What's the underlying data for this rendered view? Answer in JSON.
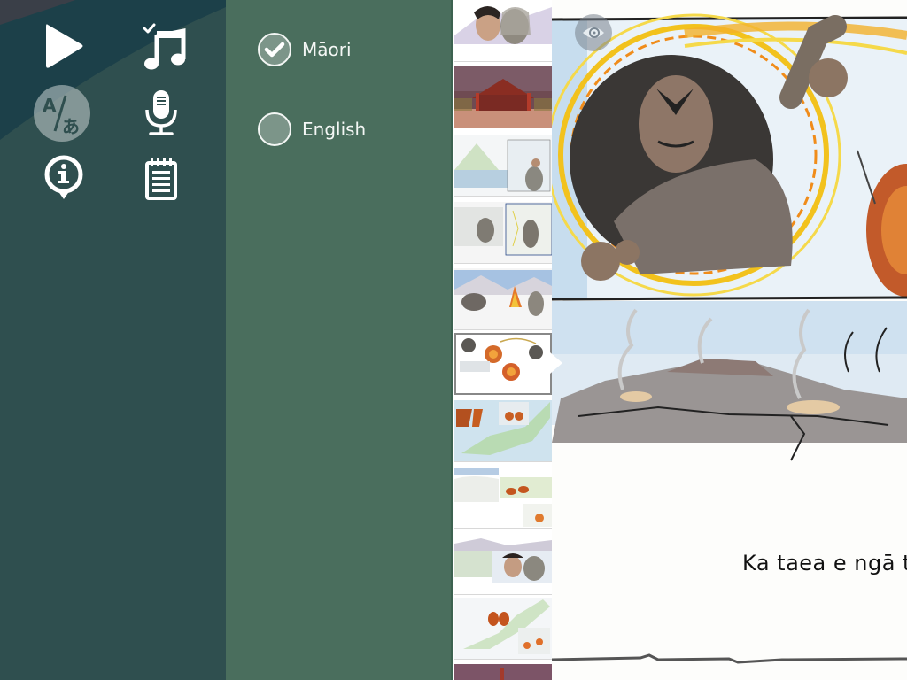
{
  "sidebar": {
    "buttons": [
      {
        "id": "play",
        "icon": "play-icon",
        "label": "Play"
      },
      {
        "id": "music",
        "icon": "music-note-icon",
        "label": "Music",
        "checked": true
      },
      {
        "id": "language",
        "icon": "translate-icon",
        "label": "Language",
        "active": true
      },
      {
        "id": "record",
        "icon": "microphone-icon",
        "label": "Record"
      },
      {
        "id": "info",
        "icon": "info-icon",
        "label": "Info"
      },
      {
        "id": "notes",
        "icon": "notepad-icon",
        "label": "Notes"
      }
    ],
    "translate_glyph_a": "A",
    "translate_glyph_b": "あ"
  },
  "language_panel": {
    "options": [
      {
        "label": "Māori",
        "selected": true
      },
      {
        "label": "English",
        "selected": false
      }
    ]
  },
  "thumbnails": {
    "count_visible": 10,
    "selected_index": 5,
    "items": [
      {
        "name": "two-figures-mountain"
      },
      {
        "name": "marae-meeting-house"
      },
      {
        "name": "mountain-lake-warrior"
      },
      {
        "name": "warriors-in-snow"
      },
      {
        "name": "fire-in-snow"
      },
      {
        "name": "fireballs-flying"
      },
      {
        "name": "map-with-fireballs"
      },
      {
        "name": "fireballs-landing"
      },
      {
        "name": "two-figures-landscape"
      },
      {
        "name": "map-fireballs-volcanoes"
      }
    ]
  },
  "page": {
    "story_text": "Ka taea e ngā t",
    "koru_icon": "koru-icon"
  },
  "colors": {
    "sidebar_bg": "#2f4f4f",
    "sidebar_top": "#1c4049",
    "panel_bg": "#4a6e5d",
    "radio_fill": "#7c9589",
    "text_light": "#f4f7f5"
  }
}
